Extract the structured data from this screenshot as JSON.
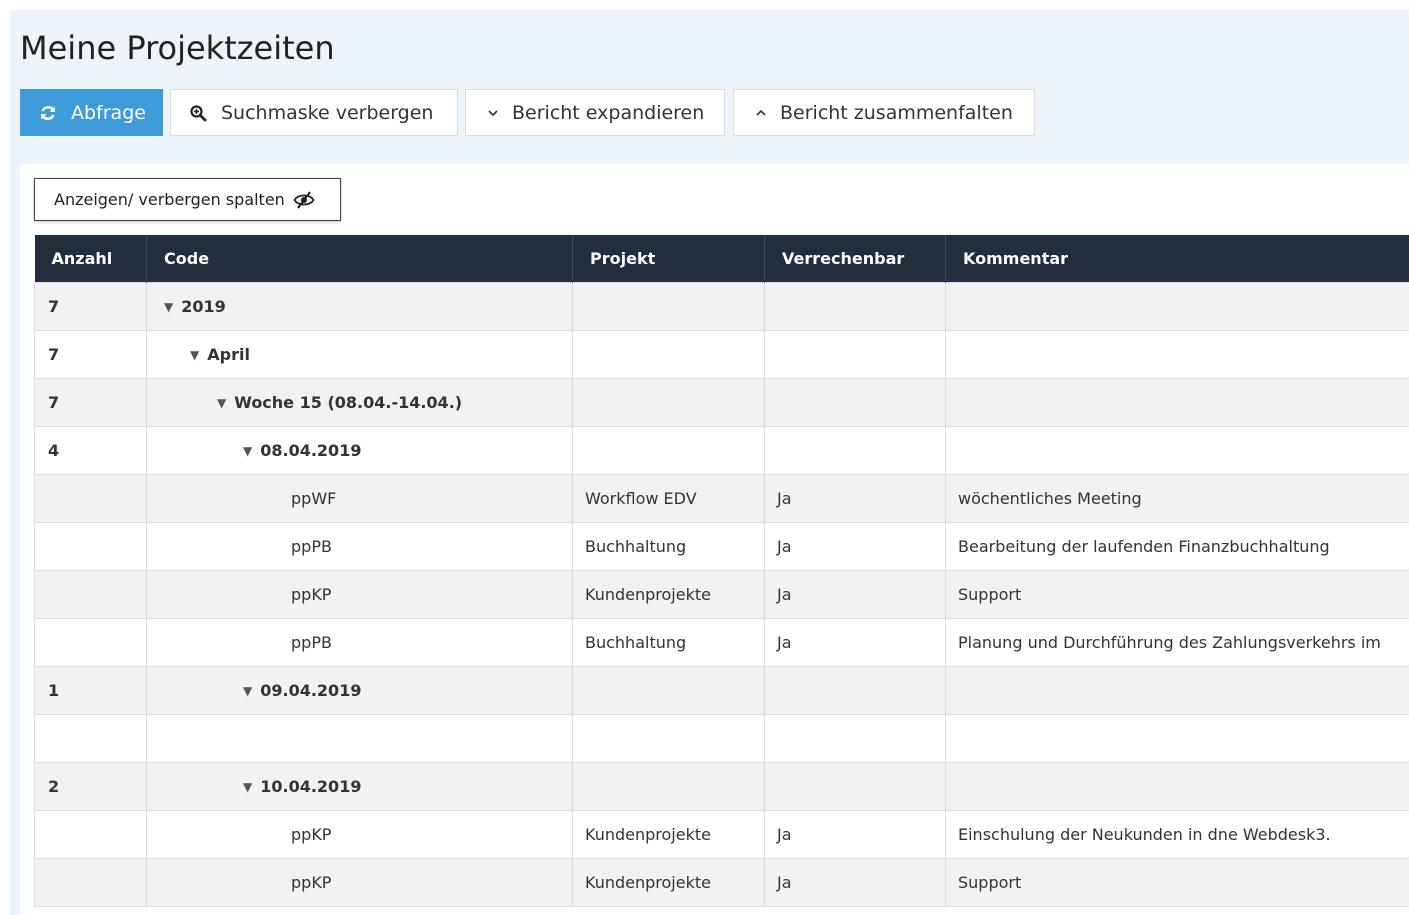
{
  "page": {
    "title": "Meine Projektzeiten"
  },
  "toolbar": {
    "query_label": "Abfrage",
    "hide_search_label": "Suchmaske verbergen",
    "expand_label": "Bericht expandieren",
    "collapse_label": "Bericht zusammenfalten"
  },
  "columns_toggle": {
    "label": "Anzeigen/ verbergen spalten"
  },
  "table": {
    "headers": [
      "Anzahl",
      "Code",
      "Projekt",
      "Verrechenbar",
      "Kommentar"
    ],
    "rows": [
      {
        "count": "7",
        "code": "2019",
        "project": "",
        "billable": "",
        "comment": ""
      },
      {
        "count": "7",
        "code": "April",
        "project": "",
        "billable": "",
        "comment": ""
      },
      {
        "count": "7",
        "code": "Woche 15 (08.04.-14.04.)",
        "project": "",
        "billable": "",
        "comment": ""
      },
      {
        "count": "4",
        "code": "08.04.2019",
        "project": "",
        "billable": "",
        "comment": ""
      },
      {
        "count": "",
        "code": "ppWF",
        "project": "Workflow EDV",
        "billable": "Ja",
        "comment": "wöchentliches Meeting"
      },
      {
        "count": "",
        "code": "ppPB",
        "project": "Buchhaltung",
        "billable": "Ja",
        "comment": "Bearbeitung der laufenden Finanzbuchhaltung"
      },
      {
        "count": "",
        "code": "ppKP",
        "project": "Kundenprojekte",
        "billable": "Ja",
        "comment": "Support"
      },
      {
        "count": "",
        "code": "ppPB",
        "project": "Buchhaltung",
        "billable": "Ja",
        "comment": "Planung und Durchführung des Zahlungsverkehrs im"
      },
      {
        "count": "1",
        "code": "09.04.2019",
        "project": "",
        "billable": "",
        "comment": ""
      },
      {
        "count": "",
        "code": "",
        "project": "",
        "billable": "",
        "comment": ""
      },
      {
        "count": "2",
        "code": "10.04.2019",
        "project": "",
        "billable": "",
        "comment": ""
      },
      {
        "count": "",
        "code": "ppKP",
        "project": "Kundenprojekte",
        "billable": "Ja",
        "comment": "Einschulung der Neukunden in dne Webdesk3."
      },
      {
        "count": "",
        "code": "ppKP",
        "project": "Kundenprojekte",
        "billable": "Ja",
        "comment": "Support"
      }
    ]
  },
  "colors": {
    "primary": "#3d9bd9",
    "header_bg": "#232e3c",
    "page_bg": "#eef4fc"
  }
}
